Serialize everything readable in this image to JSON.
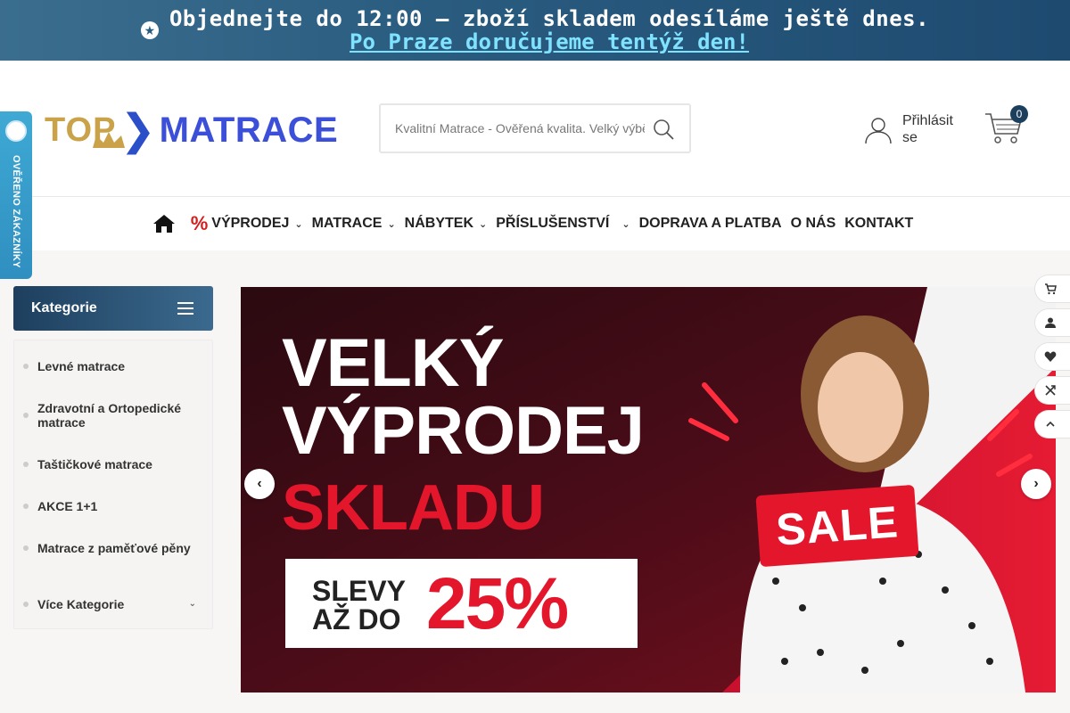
{
  "topbar": {
    "line1": "Objednejte do 12:00 – zboží skladem odesíláme ještě dnes.",
    "line2": "Po Praze doručujeme tentýž den!"
  },
  "logo": {
    "top": "TOP",
    "matrace": "MATRACE"
  },
  "search": {
    "placeholder": "Kvalitní Matrace - Ověřená kvalita. Velký výběr"
  },
  "account": {
    "login_label": "Přihlásit se"
  },
  "cart": {
    "count": "0"
  },
  "nav": {
    "items": [
      {
        "label": "VÝPRODEJ",
        "prefix": "%"
      },
      {
        "label": "MATRACE"
      },
      {
        "label": "NÁBYTEK"
      },
      {
        "label": "PŘÍSLUŠENSTVÍ"
      },
      {
        "label": "DOPRAVA A PLATBA"
      },
      {
        "label": "O NÁS"
      },
      {
        "label": "KONTAKT"
      }
    ]
  },
  "verified_badge": {
    "label": "OVĚŘENO ZÁKAZNÍKY"
  },
  "categories": {
    "title": "Kategorie",
    "items": [
      {
        "label": "Levné matrace"
      },
      {
        "label": "Zdravotní a Ortopedické matrace"
      },
      {
        "label": "Taštičkové matrace"
      },
      {
        "label": "AKCE 1+1"
      },
      {
        "label": "Matrace z paměťové pěny"
      },
      {
        "label": "Více Kategorie"
      }
    ]
  },
  "banner": {
    "line1": "VELKÝ",
    "line2": "VÝPRODEJ",
    "line3": "SKLADU",
    "discount_line1": "SLEVY",
    "discount_line2": "AŽ DO",
    "discount_value": "25%",
    "sale_tag": "SALE"
  },
  "colors": {
    "accent_navy": "#1e3f5e",
    "sale_red": "#e3162b",
    "link_cyan": "#7fe3ff"
  }
}
